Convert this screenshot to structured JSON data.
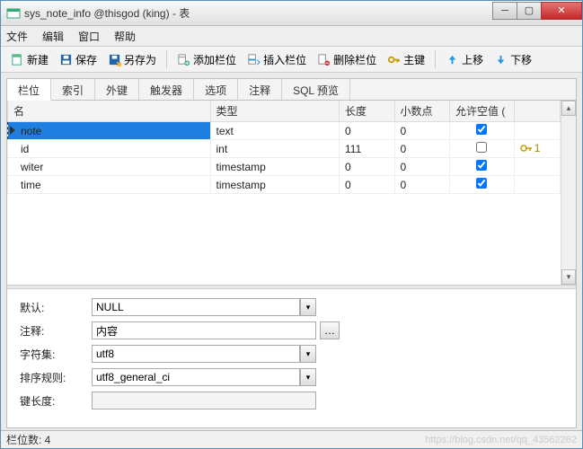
{
  "window": {
    "title": "sys_note_info @thisgod (king) - 表"
  },
  "menubar": [
    "文件",
    "编辑",
    "窗口",
    "帮助"
  ],
  "toolbar": {
    "new": "新建",
    "save": "保存",
    "saveas": "另存为",
    "addcol": "添加栏位",
    "insertcol": "插入栏位",
    "delcol": "删除栏位",
    "pk": "主键",
    "moveup": "上移",
    "movedown": "下移"
  },
  "tabs": [
    "栏位",
    "索引",
    "外键",
    "触发器",
    "选项",
    "注释",
    "SQL 预览"
  ],
  "grid": {
    "headers": {
      "name": "名",
      "type": "类型",
      "len": "长度",
      "dec": "小数点",
      "null": "允许空值 (",
      "key": ""
    },
    "rows": [
      {
        "name": "note",
        "type": "text",
        "len": "0",
        "dec": "0",
        "null": true,
        "pk": ""
      },
      {
        "name": "id",
        "type": "int",
        "len": "111",
        "dec": "0",
        "null": false,
        "pk": "1"
      },
      {
        "name": "witer",
        "type": "timestamp",
        "len": "0",
        "dec": "0",
        "null": true,
        "pk": ""
      },
      {
        "name": "time",
        "type": "timestamp",
        "len": "0",
        "dec": "0",
        "null": true,
        "pk": ""
      }
    ]
  },
  "details": {
    "labels": {
      "default": "默认:",
      "comment": "注释:",
      "charset": "字符集:",
      "collation": "排序规则:",
      "keylen": "键长度:"
    },
    "default": "NULL",
    "comment": "内容",
    "charset": "utf8",
    "collation": "utf8_general_ci",
    "keylen": ""
  },
  "status": {
    "fieldcount": "栏位数: 4"
  },
  "watermark": "https://blog.csdn.net/qq_43562262"
}
